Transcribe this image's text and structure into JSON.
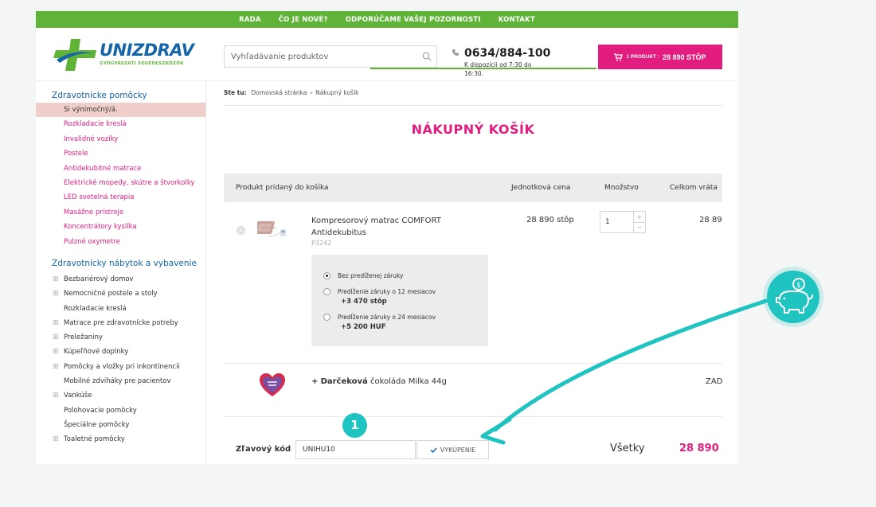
{
  "topnav": [
    "RADA",
    "ČO JE NOVÉ?",
    "ODPORÚČAME VAŠEJ POZORNOSTI",
    "KONTAKT"
  ],
  "logo": {
    "brand": "UNIZDRAV",
    "tagline": "GYÓGYÁSZATI SEGÉDESZKÖZÖK"
  },
  "search": {
    "placeholder": "Vyhľadávanie produktov"
  },
  "phone": {
    "number": "0634/884-100",
    "hours": "K dispozícii od 7:30 do 16:30."
  },
  "cart": {
    "count_label": "1 PRODUKT :",
    "total": "28 890 STÔP"
  },
  "sidebar": {
    "cat1": "Zdravotnícke pomôcky",
    "cat1_items": [
      "Si výnimočný/á.",
      "Rozkladacie kreslá",
      "Invalidné vozíky",
      "Postele",
      "Antidekubitné matrace",
      "Elektrické mopedy, skútre a štvorkolky",
      "LED svetelná terapia",
      "Masážne prístroje",
      "Koncentrátory kyslíka",
      "Pulzné oxymetre"
    ],
    "cat2": "Zdravotnícky nábytok a vybavenie",
    "cat2_items": [
      {
        "label": "Bezbariérový domov",
        "plus": "⊞"
      },
      {
        "label": "Nemocničné postele a stoly",
        "plus": "⊞"
      },
      {
        "label": "Rozkladacie kreslá",
        "plus": ""
      },
      {
        "label": "Matrace pre zdravotnícke potreby",
        "plus": "⊞"
      },
      {
        "label": "Preležaniny",
        "plus": "⊞"
      },
      {
        "label": "Kúpeľňové doplnky",
        "plus": "⊞"
      },
      {
        "label": "Pomôcky a vložky pri inkontinencii",
        "plus": "⊞"
      },
      {
        "label": "Mobilné zdviháky pre pacientov",
        "plus": ""
      },
      {
        "label": "Vankúše",
        "plus": "⊞"
      },
      {
        "label": "Polohovacie pomôcky",
        "plus": ""
      },
      {
        "label": "Špeciálne pomôcky",
        "plus": ""
      },
      {
        "label": "Toaletné pomôcky",
        "plus": "⊞"
      }
    ]
  },
  "breadcrumb": {
    "label": "Ste tu:",
    "home": "Domovská stránka",
    "sep": "»",
    "current": "Nákupný košík"
  },
  "title": "NÁKUPNÝ KOŠÍK",
  "table": {
    "col_product": "Produkt pridaný do košíka",
    "col_unit": "Jednotková cena",
    "col_qty": "Množstvo",
    "col_total": "Celkom vráta"
  },
  "product": {
    "name": "Kompresorový matrac COMFORT Antidekubitus",
    "code": "P3242",
    "unit_price": "28 890 stôp",
    "qty": "1",
    "total": "28 89"
  },
  "warranty": [
    {
      "label": "Bez predĺženej záruky",
      "price": "",
      "selected": true
    },
    {
      "label": "Predĺženie záruky o 12 mesiacov",
      "price": "+3 470 stôp",
      "selected": false
    },
    {
      "label": "Predĺženie záruky o 24 mesiacov",
      "price": "+5 200 HUF",
      "selected": false
    }
  ],
  "gift": {
    "plus": "+",
    "bold": "Darčeková",
    "rest": " čokoláda Milka 44g",
    "total": "ZAD"
  },
  "discount": {
    "label": "Zľavový kód",
    "value": "UNIHU10",
    "button": "VYKÚPENIE",
    "sum_label": "Všetky",
    "sum_value": "28 890"
  },
  "annotation": {
    "step": "1"
  },
  "colors": {
    "green": "#5fb336",
    "magenta": "#e21d7f",
    "blue": "#1565a8",
    "teal": "#1fc3c0"
  }
}
